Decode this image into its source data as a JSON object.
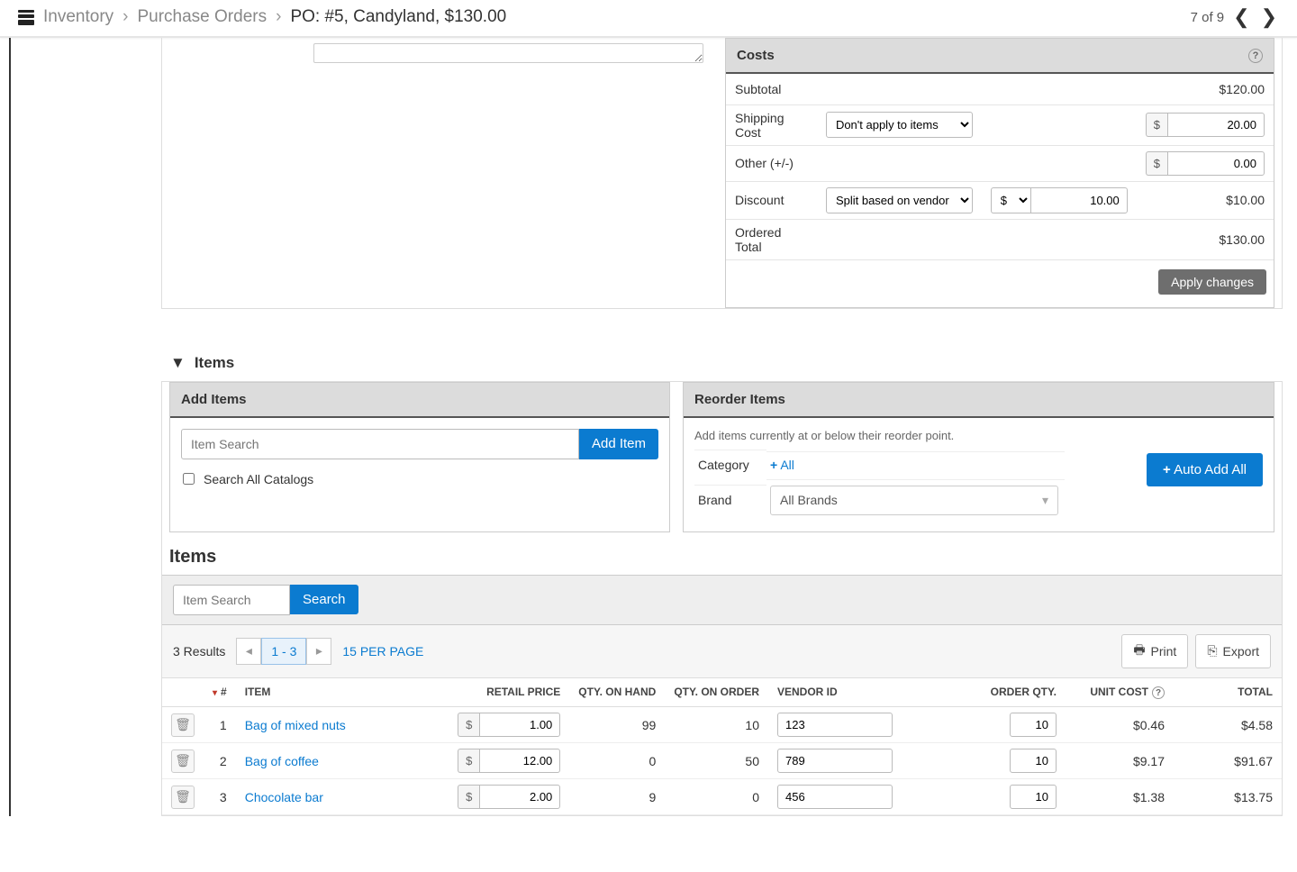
{
  "breadcrumb": {
    "level1": "Inventory",
    "level2": "Purchase Orders",
    "current": "PO:  #5, Candyland, $130.00"
  },
  "pager": {
    "label": "7 of 9"
  },
  "costs": {
    "header": "Costs",
    "rows": {
      "subtotal_label": "Subtotal",
      "subtotal_value": "$120.00",
      "shipping_label": "Shipping Cost",
      "shipping_option": "Don't apply to items",
      "shipping_prefix": "$",
      "shipping_value": "20.00",
      "other_label": "Other (+/-)",
      "other_prefix": "$",
      "other_value": "0.00",
      "discount_label": "Discount",
      "discount_option": "Split based on vendor cost",
      "discount_unit": "$",
      "discount_input": "10.00",
      "discount_value": "$10.00",
      "total_label": "Ordered Total",
      "total_value": "$130.00"
    },
    "apply_button": "Apply changes"
  },
  "items_section": {
    "toggle": "Items",
    "add_panel": {
      "header": "Add Items",
      "search_placeholder": "Item Search",
      "add_button": "Add Item",
      "checkbox_label": "Search All Catalogs"
    },
    "reorder_panel": {
      "header": "Reorder Items",
      "hint": "Add items currently at or below their reorder point.",
      "category_label": "Category",
      "all_link": "All",
      "brand_label": "Brand",
      "brand_value": "All Brands",
      "auto_button": "Auto Add All"
    }
  },
  "items_list": {
    "heading": "Items",
    "search_placeholder": "Item Search",
    "search_button": "Search",
    "results_count": "3 Results",
    "page_range": "1 - 3",
    "per_page": "15 PER PAGE",
    "print": "Print",
    "export": "Export",
    "columns": {
      "num": "#",
      "item": "ITEM",
      "retail": "RETAIL PRICE",
      "qoh": "QTY. ON HAND",
      "qoo": "QTY. ON ORDER",
      "vendor": "VENDOR ID",
      "orderqty": "ORDER QTY.",
      "unitcost": "UNIT COST",
      "total": "TOTAL"
    },
    "rows": [
      {
        "n": "1",
        "item": "Bag of mixed nuts",
        "retail": "1.00",
        "qoh": "99",
        "qoo": "10",
        "vendor": "123",
        "oq": "10",
        "uc": "$0.46",
        "total": "$4.58"
      },
      {
        "n": "2",
        "item": "Bag of coffee",
        "retail": "12.00",
        "qoh": "0",
        "qoo": "50",
        "vendor": "789",
        "oq": "10",
        "uc": "$9.17",
        "total": "$91.67"
      },
      {
        "n": "3",
        "item": "Chocolate bar",
        "retail": "2.00",
        "qoh": "9",
        "qoo": "0",
        "vendor": "456",
        "oq": "10",
        "uc": "$1.38",
        "total": "$13.75"
      }
    ]
  }
}
